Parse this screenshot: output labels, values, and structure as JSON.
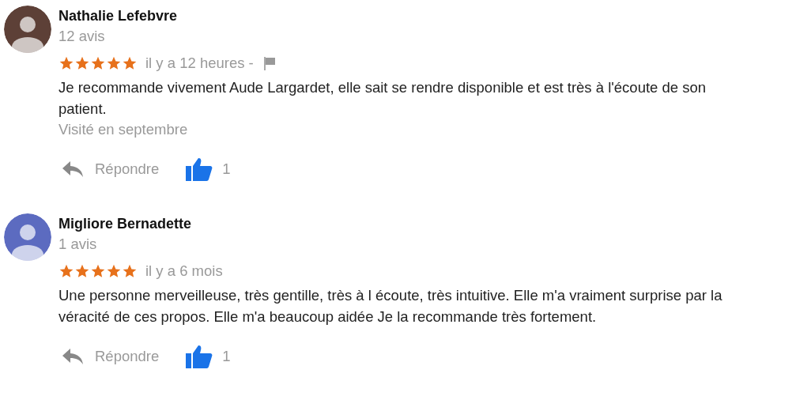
{
  "reviews": [
    {
      "name": "Nathalie Lefebvre",
      "color": "#5d4037",
      "count": "12 avis",
      "stars": 5,
      "time": "il y a 12 heures -",
      "flag": true,
      "text": "Je recommande vivement Aude Largardet, elle sait se rendre disponible et est très à l'écoute de son patient.",
      "visited": "Visité en septembre",
      "reply": "Répondre",
      "likes": "1"
    },
    {
      "name": "Migliore Bernadette",
      "color": "#5c6bc0",
      "count": "1 avis",
      "stars": 5,
      "time": "il y a 6 mois",
      "text": "Une personne merveilleuse, très gentille, très à l écoute, très intuitive. Elle m'a vraiment surprise par la véracité de ces propos. Elle m'a beaucoup aidée Je la recommande très fortement.",
      "reply": "Répondre",
      "likes": "1"
    }
  ]
}
